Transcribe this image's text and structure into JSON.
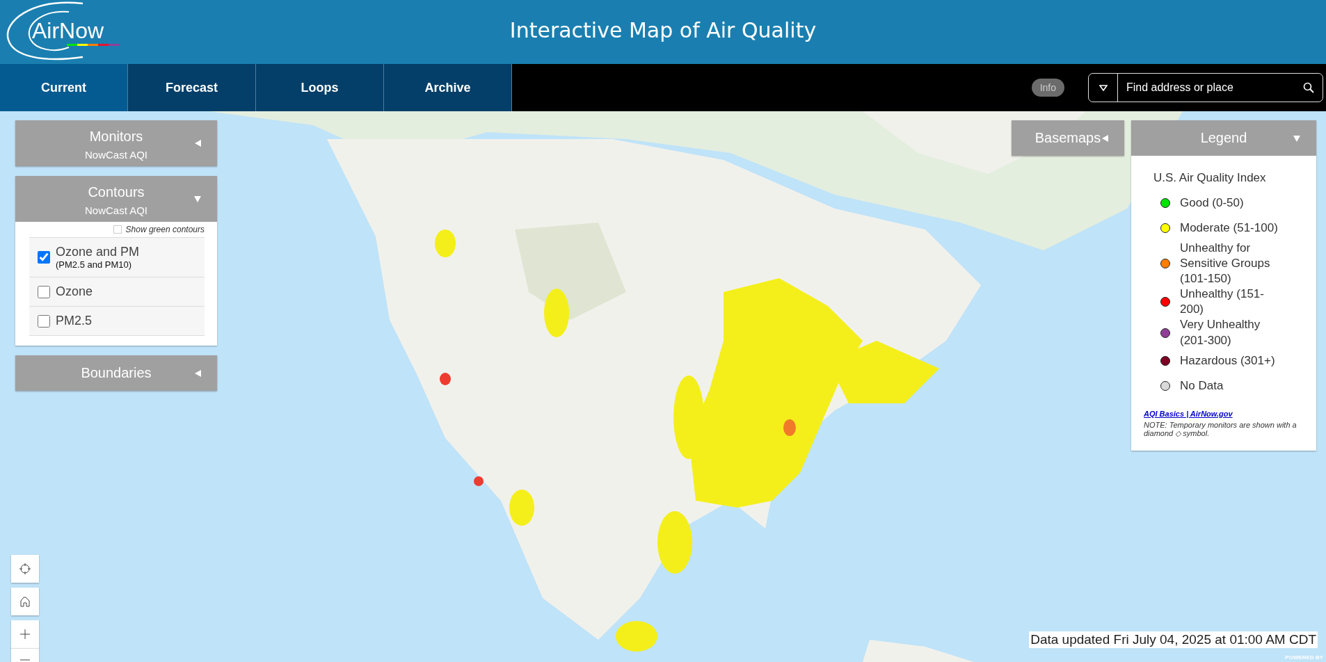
{
  "header": {
    "logo": "AirNow",
    "title": "Interactive Map of Air Quality"
  },
  "tabs": [
    {
      "label": "Current",
      "selected": true
    },
    {
      "label": "Forecast",
      "selected": false
    },
    {
      "label": "Loops",
      "selected": false
    },
    {
      "label": "Archive",
      "selected": false
    }
  ],
  "info_button": "Info",
  "search": {
    "placeholder": "Find address or place"
  },
  "left_panels": [
    {
      "title": "Monitors",
      "subtitle": "NowCast AQI",
      "expanded": false
    },
    {
      "title": "Contours",
      "subtitle": "NowCast AQI",
      "expanded": true,
      "show_green": {
        "label": "Show green contours",
        "checked": false
      },
      "options": [
        {
          "label": "Ozone and PM",
          "sublabel": "(PM2.5 and PM10)",
          "checked": true
        },
        {
          "label": "Ozone",
          "checked": false
        },
        {
          "label": "PM2.5",
          "checked": false
        }
      ]
    },
    {
      "title": "Boundaries",
      "expanded": false
    }
  ],
  "basemaps": {
    "title": "Basemaps",
    "expanded": false
  },
  "legend": {
    "title": "Legend",
    "expanded": true,
    "heading": "U.S. Air Quality Index",
    "items": [
      {
        "label": "Good (0-50)",
        "color": "#00e400"
      },
      {
        "label": "Moderate (51-100)",
        "color": "#ffff00"
      },
      {
        "label": "Unhealthy for Sensitive Groups (101-150)",
        "color": "#ff7e00"
      },
      {
        "label": "Unhealthy (151-200)",
        "color": "#ff0000"
      },
      {
        "label": "Very Unhealthy (201-300)",
        "color": "#8f3f97"
      },
      {
        "label": "Hazardous (301+)",
        "color": "#7e0023"
      },
      {
        "label": "No Data",
        "color": "#d9d9d9"
      }
    ],
    "link": "AQI Basics | AirNow.gov",
    "note": "NOTE: Temporary monitors are shown with a diamond ◇ symbol."
  },
  "status": "Data updated Fri July 04, 2025 at 01:00 AM CDT",
  "attribution": "POWERED BY"
}
